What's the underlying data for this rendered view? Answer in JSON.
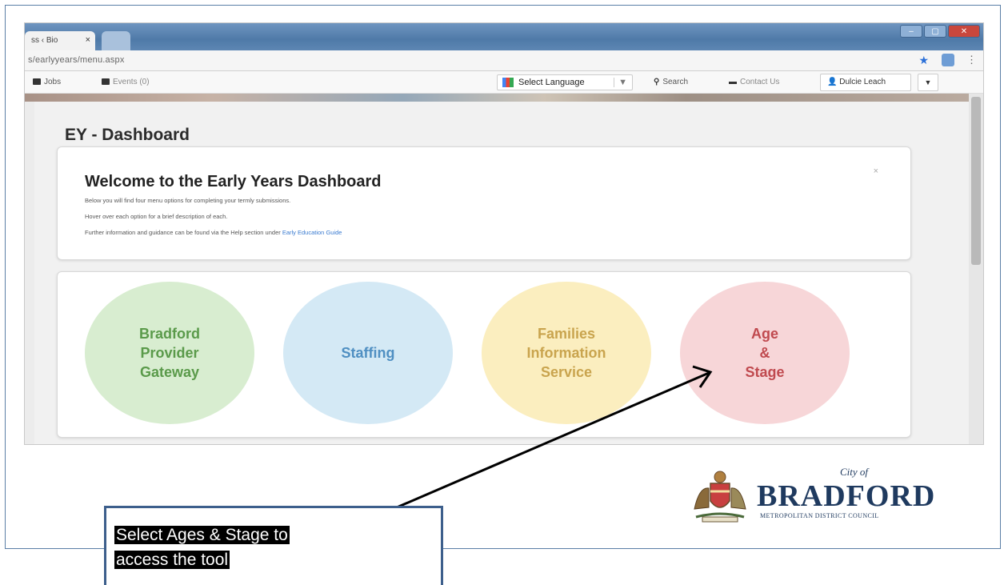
{
  "browser": {
    "tab_title": "ss ‹ Bio",
    "tab_close": "×",
    "url": "s/earlyyears/menu.aspx",
    "kebab": "⋮"
  },
  "site_nav": {
    "jobs": "Jobs",
    "events": "Events (0)",
    "select_language": "Select Language",
    "language_caret": "▼",
    "search": "Search",
    "contact": "Contact Us",
    "user": "Dulcie Leach",
    "user_caret": "▼"
  },
  "dashboard": {
    "page_title": "EY - Dashboard",
    "welcome": {
      "title": "Welcome to the Early Years Dashboard",
      "line1": "Below you will find four menu options for completing your termly submissions.",
      "line2": "Hover over each option for a brief description of each.",
      "line3_prefix": "Further information and guidance can be found via the Help section under ",
      "line3_link": "Early Education Guide",
      "close": "×"
    },
    "menu": {
      "bpg": [
        "Bradford",
        "Provider",
        "Gateway"
      ],
      "staffing": "Staffing",
      "fis": [
        "Families",
        "Information",
        "Service"
      ],
      "age_stage": [
        "Age",
        "&",
        "Stage"
      ]
    }
  },
  "logo": {
    "city_of": "City of",
    "name": "BRADFORD",
    "council": "METROPOLITAN DISTRICT COUNCIL"
  },
  "callout": {
    "line1": "Select Ages & Stage to",
    "line2": "access the tool"
  },
  "colors": {
    "frame": "#5a7ea6",
    "callout_border": "#3d5f8c",
    "bpg": "#d8edd0",
    "staffing": "#d4e9f5",
    "fis": "#fbeebf",
    "age_stage": "#f7d6d8"
  }
}
